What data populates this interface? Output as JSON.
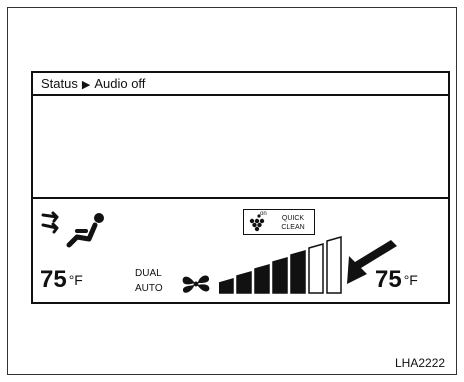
{
  "display": {
    "status": {
      "label": "Status",
      "value": "Audio off"
    },
    "left_zone": {
      "temperature": "75",
      "unit": "°F"
    },
    "right_zone": {
      "temperature": "75",
      "unit": "°F"
    },
    "mode": {
      "line1": "DUAL",
      "line2": "AUTO"
    },
    "quick_clean": {
      "indicator": "on",
      "line1": "QUICK",
      "line2": "CLEAN"
    },
    "fan_speed": {
      "level": 5,
      "max": 7
    }
  },
  "figure_code": "LHA2222",
  "icons": [
    "airflow-mode-icon",
    "fan-icon",
    "quick-clean-icon",
    "arrow-pointer-icon"
  ]
}
